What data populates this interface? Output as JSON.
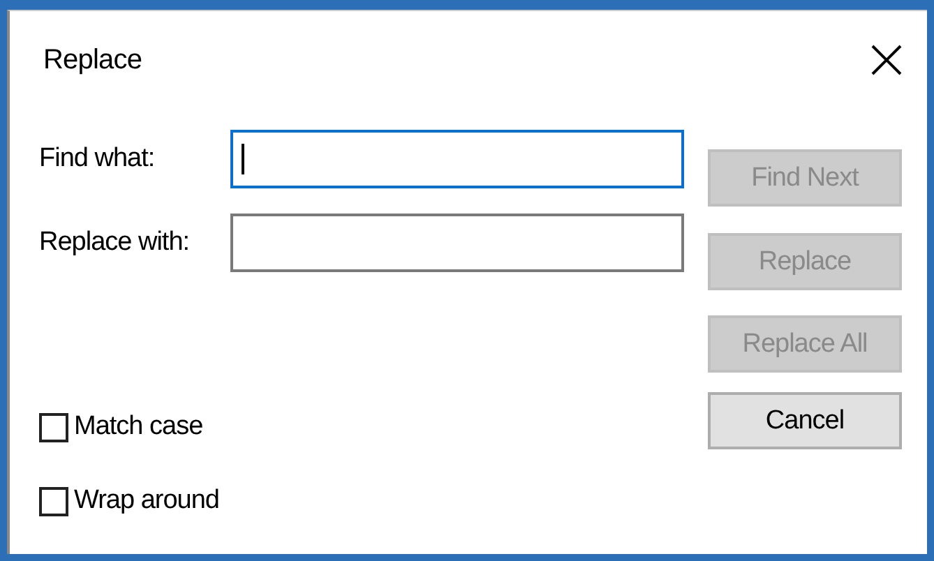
{
  "window": {
    "title": "Replace"
  },
  "fields": [
    {
      "label": "Find what:",
      "focused": true
    },
    {
      "label": "Replace with:",
      "focused": false
    }
  ],
  "buttons": [
    {
      "label": "Find Next",
      "disabled": true
    },
    {
      "label": "Replace",
      "disabled": true
    },
    {
      "label": "Replace All",
      "disabled": true
    },
    {
      "label": "Cancel",
      "disabled": false
    }
  ],
  "checkboxes": [
    {
      "label": "Match case",
      "checked": false
    },
    {
      "label": "Wrap around",
      "checked": false
    }
  ]
}
